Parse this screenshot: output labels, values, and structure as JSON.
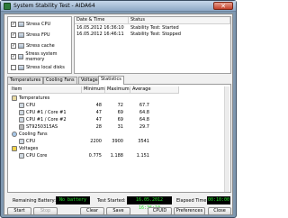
{
  "window": {
    "title": "System Stability Test - AIDA64",
    "close_glyph": "✕"
  },
  "stress_options": [
    {
      "label": "Stress CPU",
      "checked": true,
      "mark": "✓"
    },
    {
      "label": "Stress FPU",
      "checked": true,
      "mark": "✓"
    },
    {
      "label": "Stress cache",
      "checked": true,
      "mark": "✓"
    },
    {
      "label": "Stress system memory",
      "checked": true,
      "mark": "✓"
    },
    {
      "label": "Stress local disks",
      "checked": false,
      "mark": ""
    }
  ],
  "status_table": {
    "headers": [
      "Date & Time",
      "Status"
    ],
    "rows": [
      [
        "16.05.2012 16:36:10",
        "Stability Test: Started"
      ],
      [
        "16.05.2012 16:46:11",
        "Stability Test: Stopped"
      ]
    ]
  },
  "tabs": [
    "Temperatures",
    "Cooling Fans",
    "Voltages",
    "Statistics"
  ],
  "active_tab": "Statistics",
  "statistics": {
    "headers": [
      "Item",
      "Minimum",
      "Maximum",
      "Average"
    ],
    "sections": [
      {
        "name": "Temperatures",
        "rows": [
          {
            "item": "CPU",
            "min": "48",
            "max": "72",
            "avg": "67.7"
          },
          {
            "item": "CPU #1 / Core #1",
            "min": "47",
            "max": "69",
            "avg": "64.8"
          },
          {
            "item": "CPU #1 / Core #2",
            "min": "47",
            "max": "69",
            "avg": "64.8"
          },
          {
            "item": "ST9250315AS",
            "min": "28",
            "max": "31",
            "avg": "29.7"
          }
        ]
      },
      {
        "name": "Cooling Fans",
        "rows": [
          {
            "item": "CPU",
            "min": "2200",
            "max": "3900",
            "avg": "3541"
          }
        ]
      },
      {
        "name": "Voltages",
        "rows": [
          {
            "item": "CPU Core",
            "min": "0.775",
            "max": "1.188",
            "avg": "1.151"
          }
        ]
      }
    ]
  },
  "status_bar": {
    "remaining_battery_label": "Remaining Battery:",
    "remaining_battery_value": "No battery",
    "test_started_label": "Test Started:",
    "test_started_value": "16.05.2012 16:36:10",
    "elapsed_time_label": "Elapsed Time:",
    "elapsed_time_value": "00:10:00"
  },
  "buttons": {
    "start": "Start",
    "stop": "Stop",
    "clear": "Clear",
    "save": "Save",
    "cpuid": "CPUID",
    "preferences": "Preferences",
    "close": "Close"
  },
  "colors": {
    "lcd_text": "#26e02a",
    "lcd_bg": "#000000",
    "title_gradient_top": "#c5d6e9"
  }
}
